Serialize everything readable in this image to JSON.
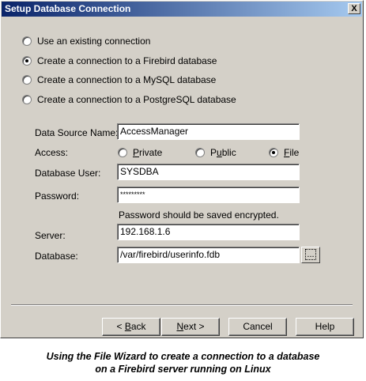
{
  "window": {
    "title": "Setup Database Connection",
    "close_glyph": "X"
  },
  "connection_options": [
    {
      "label": "Use an existing connection",
      "selected": false
    },
    {
      "label": "Create a connection to a Firebird database",
      "selected": true
    },
    {
      "label": "Create a connection to a MySQL database",
      "selected": false
    },
    {
      "label": "Create a connection to a PostgreSQL database",
      "selected": false
    }
  ],
  "form": {
    "data_source_label": "Data Source Name:",
    "data_source_value": "AccessManager",
    "access_label": "Access:",
    "access_options": [
      {
        "prefix": "",
        "mnemonic": "P",
        "rest": "rivate",
        "selected": false
      },
      {
        "prefix": "P",
        "mnemonic": "u",
        "rest": "blic",
        "selected": false
      },
      {
        "prefix": "",
        "mnemonic": "F",
        "rest": "ile",
        "selected": true
      }
    ],
    "user_label": "Database User:",
    "user_value": "SYSDBA",
    "password_label": "Password:",
    "password_value": "*********",
    "password_note": "Password should be saved encrypted.",
    "server_label": "Server:",
    "server_value": "192.168.1.6",
    "database_label": "Database:",
    "database_value": "/var/firebird/userinfo.fdb",
    "browse_label": "..."
  },
  "buttons": {
    "back_prefix": "< ",
    "back_mnemonic": "B",
    "back_rest": "ack",
    "next_mnemonic": "N",
    "next_rest": "ext >",
    "cancel": "Cancel",
    "help": "Help"
  },
  "caption": {
    "line1": "Using the File Wizard to create a connection to a database",
    "line2": "on a Firebird server running on Linux"
  },
  "colors": {
    "face": "#d4d0c8",
    "titlebar_start": "#0a246a",
    "titlebar_end": "#a6caf0"
  }
}
